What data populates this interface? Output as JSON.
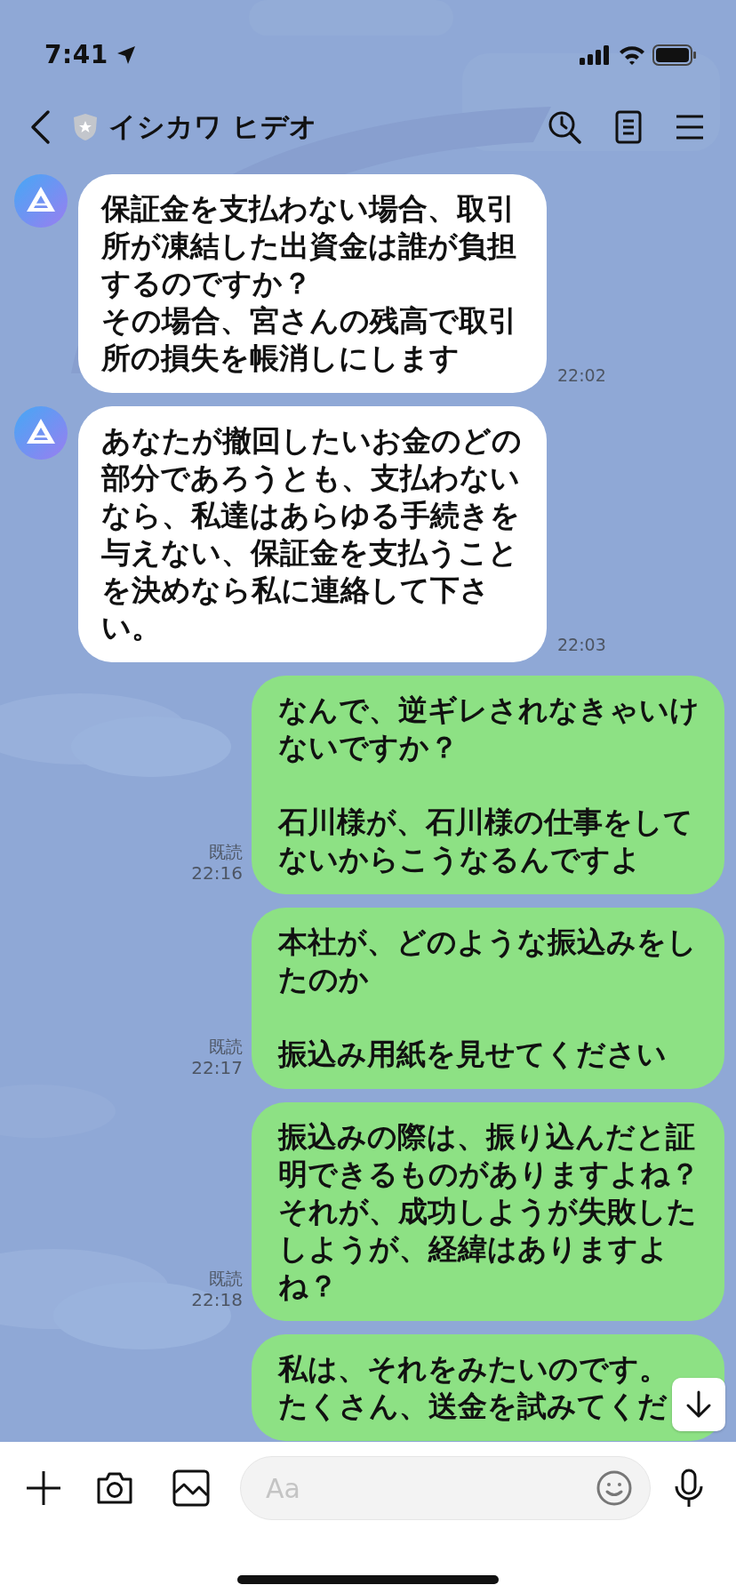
{
  "status_bar": {
    "time": "7:41"
  },
  "header": {
    "title": "イシカワ ヒデオ"
  },
  "messages": [
    {
      "kind": "incoming",
      "blocks": [
        [
          "保証金を支払わない場合、取引所が凍結した出資金は誰が負担するのですか？",
          "その場合、宮さんの残高で取引所の損失を帳消しにします"
        ]
      ],
      "time": "22:02"
    },
    {
      "kind": "incoming",
      "blocks": [
        [
          "あなたが撤回したいお金のどの部分であろうとも、支払わないなら、私達はあらゆる手続きを与えない、保証金を支払うことを決めなら私に連絡して下さい。"
        ]
      ],
      "time": "22:03"
    },
    {
      "kind": "outgoing",
      "blocks": [
        [
          "なんで、逆ギレされなきゃいけないですか？"
        ],
        [
          "石川様が、石川様の仕事をしてないからこうなるんですよ"
        ]
      ],
      "read": "既読",
      "time": "22:16"
    },
    {
      "kind": "outgoing",
      "blocks": [
        [
          "本社が、どのような振込みをしたのか"
        ],
        [
          "振込み用紙を見せてください"
        ]
      ],
      "read": "既読",
      "time": "22:17"
    },
    {
      "kind": "outgoing",
      "blocks": [
        [
          "振込みの際は、振り込んだと証明できるものがありますよね？それが、成功しようが失敗したしようが、経緯はありますよね？"
        ]
      ],
      "read": "既読",
      "time": "22:18"
    },
    {
      "kind": "outgoing",
      "blocks": [
        [
          "私は、それをみたいのです。",
          "たくさん、送金を試みてくだ"
        ]
      ]
    }
  ],
  "composer": {
    "placeholder": "Aa"
  }
}
